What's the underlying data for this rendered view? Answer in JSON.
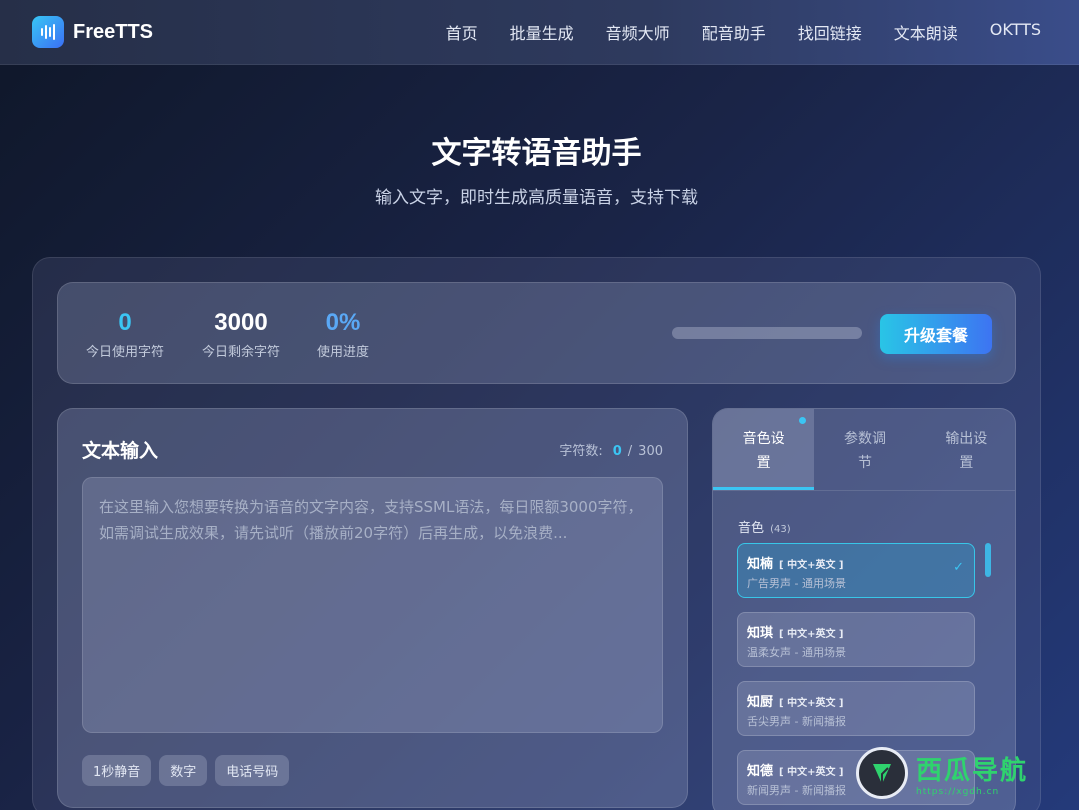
{
  "app": {
    "name": "FreeTTS",
    "nav": [
      "首页",
      "批量生成",
      "音频大师",
      "配音助手",
      "找回链接",
      "文本朗读",
      "OKTTS"
    ]
  },
  "hero": {
    "title": "文字转语音助手",
    "subtitle": "输入文字，即时生成高质量语音，支持下载"
  },
  "stats": {
    "used_value": "0",
    "used_label": "今日使用字符",
    "remaining_value": "3000",
    "remaining_label": "今日剩余字符",
    "progress_value": "0%",
    "progress_label": "使用进度",
    "progress_fraction": 0,
    "upgrade_label": "升级套餐"
  },
  "editor": {
    "title": "文本输入",
    "count_label": "字符数:",
    "count_current": "0",
    "count_sep": "/",
    "count_max": "300",
    "placeholder": "在这里输入您想要转换为语音的文字内容，支持SSML语法，每日限额3000字符，如需调试生成效果，请先试听（播放前20字符）后再生成，以免浪费...",
    "tags": [
      "1秒静音",
      "数字",
      "电话号码"
    ]
  },
  "voice_panel": {
    "tabs": [
      "音色设置",
      "参数调节",
      "输出设置"
    ],
    "active_tab": 0,
    "section_label": "音色",
    "section_count": "(43)",
    "voices": [
      {
        "name": "知楠",
        "lang": "[ 中文+英文 ]",
        "desc": "广告男声 - 通用场景",
        "selected": true
      },
      {
        "name": "知琪",
        "lang": "[ 中文+英文 ]",
        "desc": "温柔女声 - 通用场景",
        "selected": false
      },
      {
        "name": "知厨",
        "lang": "[ 中文+英文 ]",
        "desc": "舌尖男声 - 新闻播报",
        "selected": false
      },
      {
        "name": "知德",
        "lang": "[ 中文+英文 ]",
        "desc": "新闻男声 - 新闻播报",
        "selected": false
      }
    ]
  },
  "watermark": {
    "text": "西瓜导航",
    "url": "https://xgdh.cn"
  },
  "colors": {
    "accent": "#3bc5f3",
    "button_start": "#29c5e6",
    "button_end": "#3d74f2",
    "watermark_green": "#2fd36e"
  }
}
